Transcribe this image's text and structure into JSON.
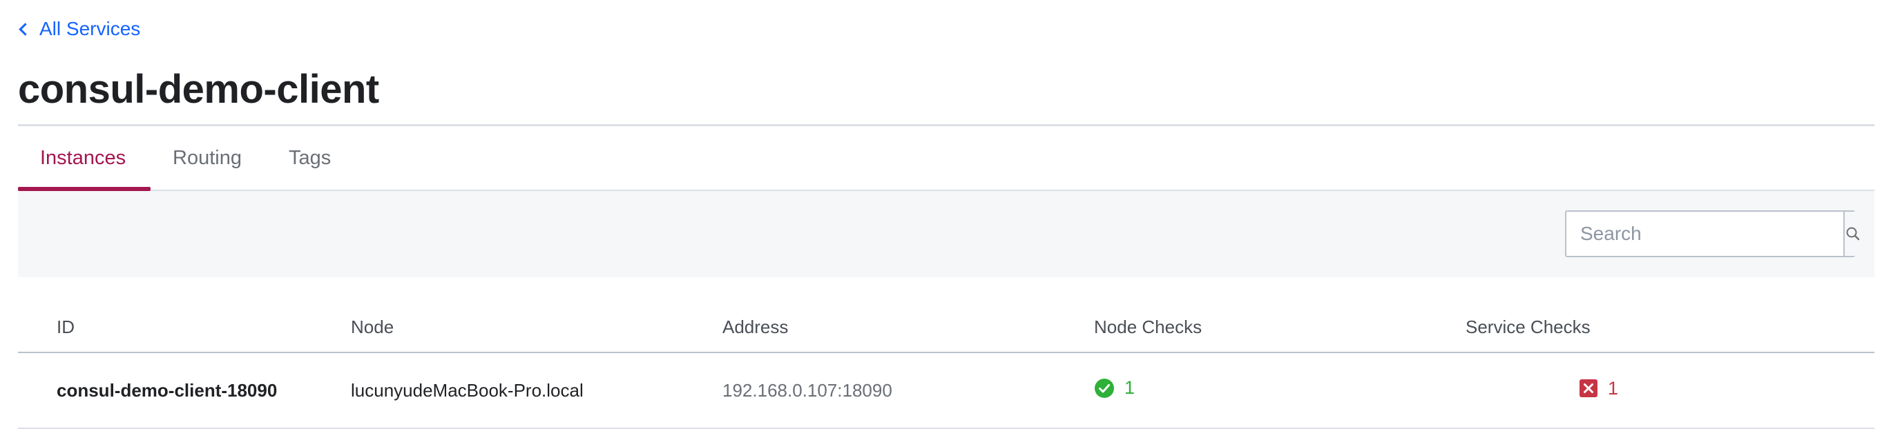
{
  "breadcrumb": {
    "label": "All Services"
  },
  "page": {
    "title": "consul-demo-client"
  },
  "tabs": [
    {
      "label": "Instances",
      "active": true
    },
    {
      "label": "Routing",
      "active": false
    },
    {
      "label": "Tags",
      "active": false
    }
  ],
  "search": {
    "placeholder": "Search",
    "value": ""
  },
  "table": {
    "headers": [
      "ID",
      "Node",
      "Address",
      "Node Checks",
      "Service Checks"
    ],
    "rows": [
      {
        "id": "consul-demo-client-18090",
        "node": "lucunyudeMacBook-Pro.local",
        "address": "192.168.0.107:18090",
        "node_checks": {
          "status": "passing",
          "count": "1",
          "icon": "check-circle-icon"
        },
        "service_checks": {
          "status": "critical",
          "count": "1",
          "icon": "x-square-icon"
        }
      }
    ]
  },
  "colors": {
    "link": "#1563ff",
    "tab_active": "#a3174f",
    "passing": "#2eb039",
    "critical": "#c73445"
  }
}
